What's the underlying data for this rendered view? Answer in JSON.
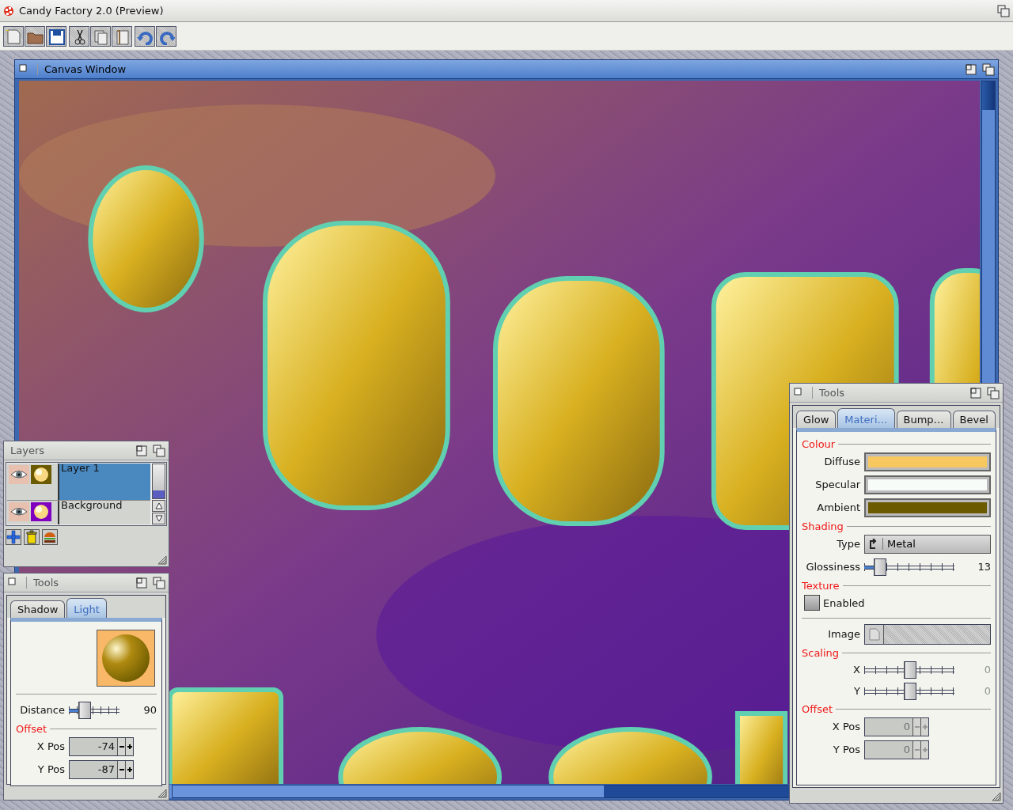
{
  "screen": {
    "title": "Candy Factory 2.0 (Preview)"
  },
  "toolbar": {
    "groups": [
      [
        {
          "kind": "new"
        },
        {
          "kind": "open"
        },
        {
          "kind": "save"
        }
      ],
      [
        {
          "kind": "cut"
        },
        {
          "kind": "copy"
        },
        {
          "kind": "paste"
        }
      ],
      [
        {
          "kind": "undo"
        },
        {
          "kind": "redo"
        }
      ]
    ]
  },
  "canvas_window": {
    "title": "Canvas Window"
  },
  "layers_window": {
    "title": "Layers",
    "layers": [
      {
        "name": "Layer 1",
        "selected": true,
        "color": "#6b5a00"
      },
      {
        "name": "Background",
        "selected": false,
        "color": "#8000c0"
      }
    ],
    "buttons": [
      {
        "kind": "add"
      },
      {
        "kind": "delete"
      },
      {
        "kind": "merge"
      }
    ]
  },
  "light_tools": {
    "title": "Tools",
    "tabs": [
      {
        "label": "Shadow",
        "selected": false
      },
      {
        "label": "Light",
        "selected": true
      }
    ],
    "distance": {
      "label": "Distance",
      "level": 0.3,
      "reading": "90"
    },
    "offset": {
      "heading": "Offset",
      "fields": [
        {
          "label": "X Pos",
          "value": "-74",
          "disabled": false
        },
        {
          "label": "Y Pos",
          "value": "-87",
          "disabled": false
        }
      ]
    }
  },
  "material_tools": {
    "title": "Tools",
    "tabs": [
      {
        "label": "Glow",
        "selected": false
      },
      {
        "label": "Materi…",
        "selected": true
      },
      {
        "label": "Bump…",
        "selected": false
      },
      {
        "label": "Bevel",
        "selected": false
      }
    ],
    "colour": {
      "heading": "Colour",
      "swatches": [
        {
          "label": "Diffuse",
          "color": "#f8c860"
        },
        {
          "label": "Specular",
          "color": "#f8fcf8"
        },
        {
          "label": "Ambient",
          "color": "#6b5a00"
        }
      ]
    },
    "shading": {
      "heading": "Shading",
      "type": {
        "label": "Type",
        "value": "Metal"
      },
      "glossiness": {
        "label": "Glossiness",
        "level": 0.17,
        "reading": "13"
      }
    },
    "texture": {
      "heading": "Texture",
      "enabled": {
        "label": "Enabled",
        "checked": false
      },
      "image": {
        "label": "Image",
        "disabled": true
      }
    },
    "scaling": {
      "heading": "Scaling",
      "sliders": [
        {
          "label": "X",
          "level": 0.5,
          "reading": "0",
          "disabled": true
        },
        {
          "label": "Y",
          "level": 0.5,
          "reading": "0",
          "disabled": true
        }
      ]
    },
    "offset": {
      "heading": "Offset",
      "fields": [
        {
          "label": "X Pos",
          "value": "0",
          "disabled": true
        },
        {
          "label": "Y Pos",
          "value": "0",
          "disabled": true
        }
      ]
    }
  }
}
